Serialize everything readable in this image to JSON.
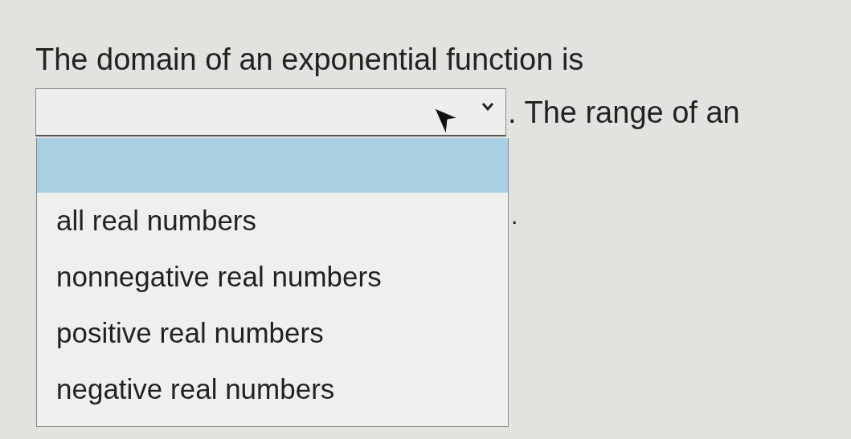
{
  "question": {
    "text_before": "The domain of an exponential function is",
    "text_after": ". The range of an",
    "trailing_text": "."
  },
  "dropdown": {
    "expanded": true,
    "options": [
      {
        "kind": "blank",
        "selected": true
      },
      {
        "kind": "option",
        "label": "all real numbers",
        "selected": false
      },
      {
        "kind": "option",
        "label": "nonnegative real numbers",
        "selected": false
      },
      {
        "kind": "option",
        "label": "positive real numbers",
        "selected": false
      },
      {
        "kind": "option",
        "label": "negative real numbers",
        "selected": false
      }
    ]
  }
}
